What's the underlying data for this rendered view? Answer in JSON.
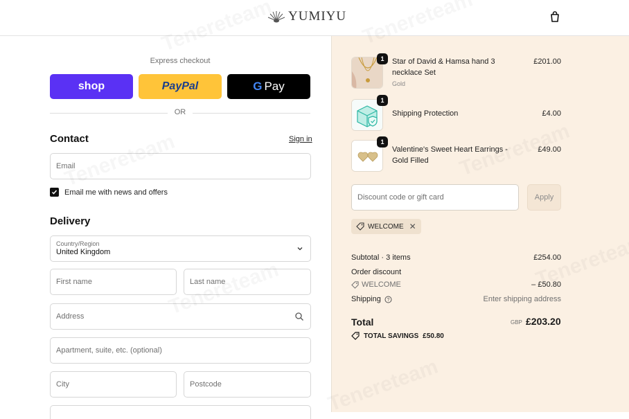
{
  "brand": {
    "name": "YUMIYU"
  },
  "header": {
    "cart_icon": "shopping-bag-icon"
  },
  "express": {
    "title": "Express checkout",
    "shop_label": "shop",
    "paypal_label": "PayPal",
    "gpay_g": "G",
    "gpay_label": "Pay",
    "divider_text": "OR"
  },
  "contact": {
    "title": "Contact",
    "signin": "Sign in",
    "email_placeholder": "Email",
    "newsletter_label": "Email me with news and offers",
    "newsletter_checked": true
  },
  "delivery": {
    "title": "Delivery",
    "country_label": "Country/Region",
    "country_value": "United Kingdom",
    "first_name": "First name",
    "last_name": "Last name",
    "address": "Address",
    "apartment": "Apartment, suite, etc. (optional)",
    "city": "City",
    "postcode": "Postcode"
  },
  "cart": {
    "items": [
      {
        "name": "Star of David & Hamsa hand 3 necklace Set",
        "variant": "Gold",
        "qty": "1",
        "price": "£201.00"
      },
      {
        "name": "Shipping Protection",
        "variant": "",
        "qty": "1",
        "price": "£4.00"
      },
      {
        "name": "Valentine's Sweet Heart Earrings - Gold Filled",
        "variant": "",
        "qty": "1",
        "price": "£49.00"
      }
    ],
    "discount_placeholder": "Discount code or gift card",
    "apply_label": "Apply",
    "applied_code": "WELCOME"
  },
  "summary": {
    "subtotal_label": "Subtotal · 3 items",
    "subtotal_value": "£254.00",
    "order_discount_label": "Order discount",
    "discount_code": "WELCOME",
    "discount_value": "– £50.80",
    "shipping_label": "Shipping",
    "shipping_value": "Enter shipping address",
    "total_label": "Total",
    "currency": "GBP",
    "total_value": "£203.20",
    "savings_label": "TOTAL SAVINGS",
    "savings_value": "£50.80"
  },
  "watermark": "Tenereteam",
  "colors": {
    "shop": "#5a31f4",
    "paypal": "#ffc439",
    "gpay": "#000000",
    "summary_bg": "#fbf0e3"
  }
}
